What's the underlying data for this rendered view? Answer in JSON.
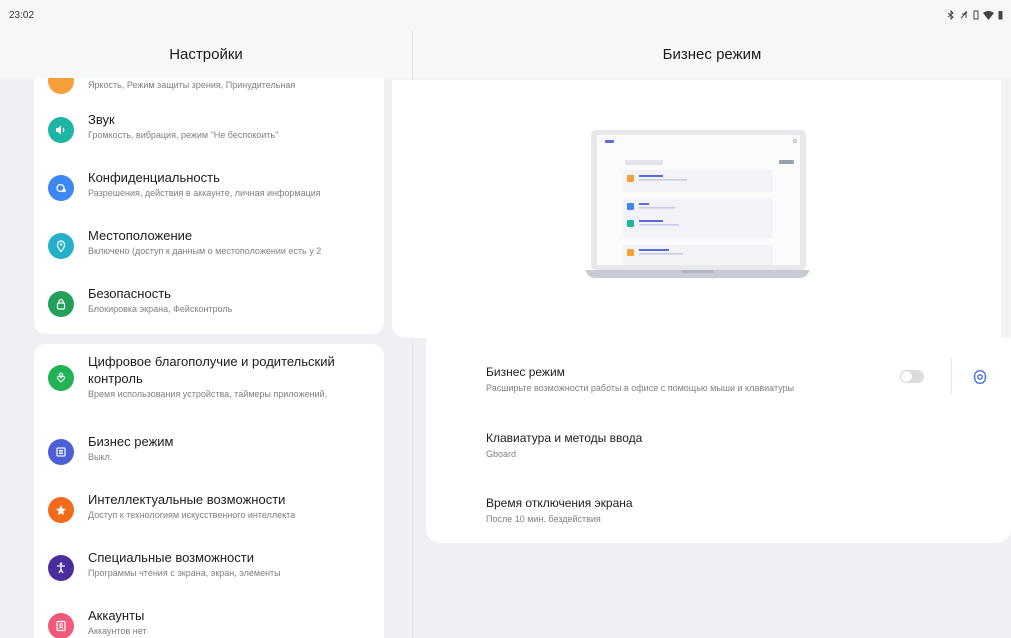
{
  "status": {
    "time": "23:02"
  },
  "left": {
    "title": "Настройки",
    "card1": [
      {
        "title": "",
        "sub": "Яркость, Режим защиты зрения, Принудительная",
        "icon": "sun-icon",
        "color": "#f5a03a"
      },
      {
        "title": "Звук",
        "sub": "Громкость, вибрация, режим \"Не беспокоить\"",
        "icon": "speaker-icon",
        "color": "#1fb5a4"
      },
      {
        "title": "Конфиденциальность",
        "sub": "Разрешения, действия в аккаунте, личная информация",
        "icon": "privacy-icon",
        "color": "#3d86f4"
      },
      {
        "title": "Местоположение",
        "sub": "Включено (доступ к данным о местоположении есть у 2",
        "icon": "location-icon",
        "color": "#24b0c8"
      },
      {
        "title": "Безопасность",
        "sub": "Блокировка экрана, Фейсконтроль",
        "icon": "lock-icon",
        "color": "#23a05a"
      }
    ],
    "card2": [
      {
        "title": "Цифровое благополучие и родительский контроль",
        "sub": "Время использования устройства, таймеры приложений,",
        "icon": "wellbeing-icon",
        "color": "#23b357"
      },
      {
        "title": "Бизнес режим",
        "sub": "Выкл.",
        "icon": "business-icon",
        "color": "#4b5fd6"
      },
      {
        "title": "Интеллектуальные возможности",
        "sub": "Доступ к технологиям искусственного интеллекта",
        "icon": "star-icon",
        "color": "#f26b1d"
      },
      {
        "title": "Специальные возможности",
        "sub": "Программы чтения с экрана, экран, элементы",
        "icon": "accessibility-icon",
        "color": "#4a2d9c"
      },
      {
        "title": "Аккаунты",
        "sub": "Аккаунтов нет",
        "icon": "account-icon",
        "color": "#ef5a7a"
      }
    ]
  },
  "right": {
    "title": "Бизнес режим",
    "business_mode": {
      "title": "Бизнес режим",
      "sub": "Расширьте возможности работы в офисе с помощью мыши и клавиатуры",
      "enabled": false
    },
    "keyboard": {
      "title": "Клавиатура и методы ввода",
      "sub": "Gboard"
    },
    "screen_timeout": {
      "title": "Время отключения экрана",
      "sub": "После 10 мин. бездействия"
    }
  },
  "colors": {
    "accent": "#3d6bd8",
    "toggle_off": "#dcdcdc"
  }
}
